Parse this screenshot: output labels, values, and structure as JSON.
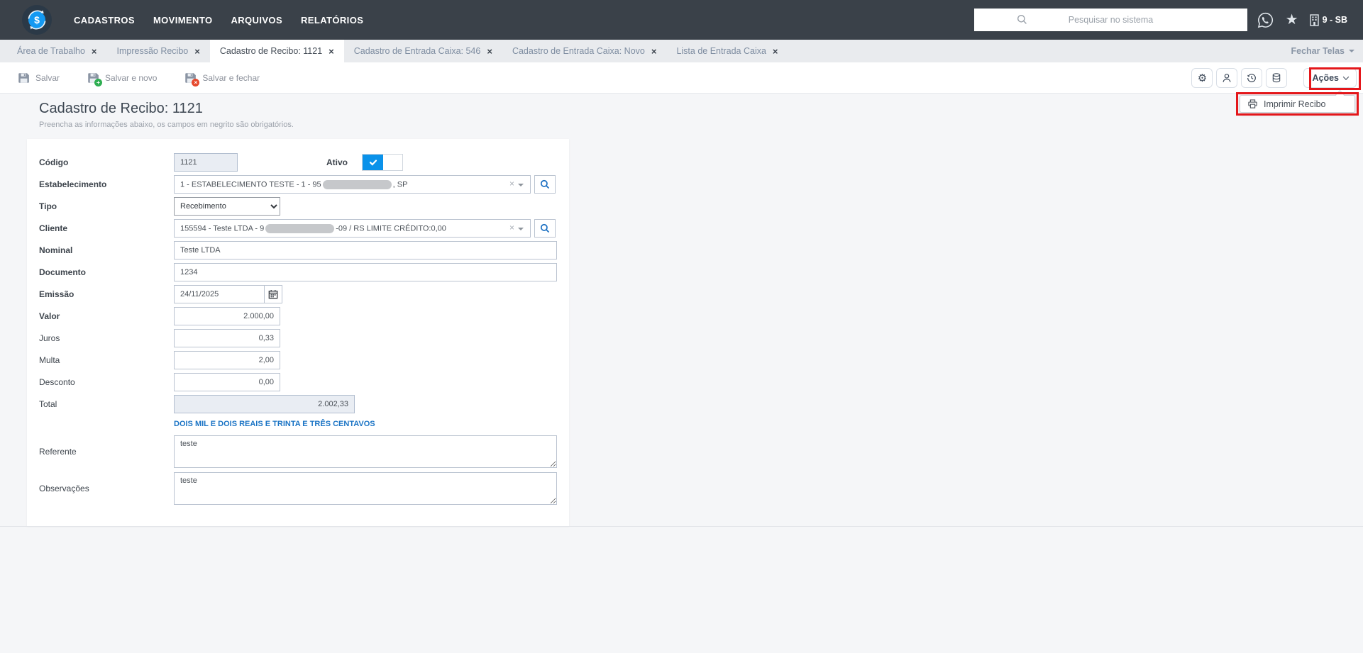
{
  "colors": {
    "navbar_bg": "#3a4149",
    "accent_blue": "#1499f2",
    "toggle_on_blue": "#0a92ea",
    "annotation_red": "#e4171b",
    "amount_words_blue": "#1b74c5",
    "tabbar_bg": "#e9ebee"
  },
  "icons": {
    "close": "×",
    "clear": "×",
    "dollar": "$",
    "gear": "⚙",
    "star": "★"
  },
  "navbar": {
    "menu": [
      "CADASTROS",
      "MOVIMENTO",
      "ARQUIVOS",
      "RELATÓRIOS"
    ],
    "search_placeholder": "Pesquisar no sistema",
    "company_badge": "9 - SB"
  },
  "tabs": {
    "items": [
      {
        "label": "Área de Trabalho"
      },
      {
        "label": "Impressão Recibo"
      },
      {
        "label": "Cadastro de Recibo: 1121"
      },
      {
        "label": "Cadastro de Entrada Caixa: 546"
      },
      {
        "label": "Cadastro de Entrada Caixa: Novo"
      },
      {
        "label": "Lista de Entrada Caixa"
      }
    ],
    "close_screens": "Fechar Telas"
  },
  "toolbar": {
    "save": "Salvar",
    "save_new": "Salvar e novo",
    "save_close": "Salvar e fechar",
    "actions": "Ações"
  },
  "actions_menu": {
    "print_receipt": "Imprimir Recibo"
  },
  "page": {
    "title": "Cadastro de Recibo: 1121",
    "subtitle": "Preencha as informações abaixo, os campos em negrito são obrigatórios."
  },
  "form": {
    "codigo": {
      "label": "Código",
      "value": "1121"
    },
    "ativo": {
      "label": "Ativo",
      "checked": true
    },
    "estabelecimento": {
      "label": "Estabelecimento",
      "value_prefix": "1 - ESTABELECIMENTO TESTE - 1 - 95",
      "value_suffix": ", SP",
      "redacted": true
    },
    "tipo": {
      "label": "Tipo",
      "value": "Recebimento"
    },
    "cliente": {
      "label": "Cliente",
      "value_prefix": "155594 - Teste LTDA - 9",
      "value_suffix": "-09 / RS LIMITE CRÉDITO:0,00",
      "redacted": true
    },
    "nominal": {
      "label": "Nominal",
      "value": "Teste LTDA"
    },
    "documento": {
      "label": "Documento",
      "value": "1234"
    },
    "emissao": {
      "label": "Emissão",
      "value": "24/11/2025"
    },
    "valor": {
      "label": "Valor",
      "value": "2.000,00"
    },
    "juros": {
      "label": "Juros",
      "value": "0,33"
    },
    "multa": {
      "label": "Multa",
      "value": "2,00"
    },
    "desconto": {
      "label": "Desconto",
      "value": "0,00"
    },
    "total": {
      "label": "Total",
      "value": "2.002,33",
      "in_words": "DOIS MIL E DOIS REAIS E TRINTA E TRÊS CENTAVOS"
    },
    "referente": {
      "label": "Referente",
      "value": "teste"
    },
    "observacoes": {
      "label": "Observações",
      "value": "teste"
    }
  }
}
